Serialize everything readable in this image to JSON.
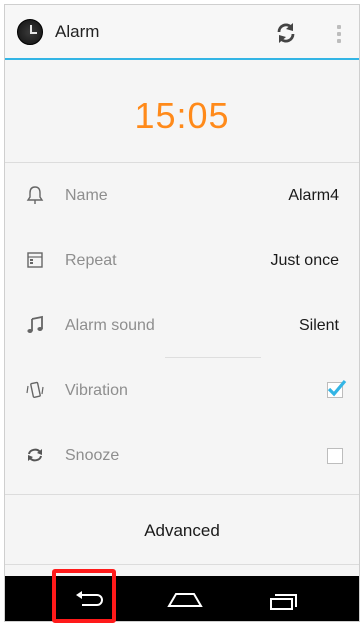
{
  "app": {
    "title": "Alarm",
    "icon": "alarm-clock-icon"
  },
  "action_bar": {
    "refresh_icon": "refresh-icon",
    "overflow_icon": "overflow-menu-icon",
    "accent_color": "#33b5e5"
  },
  "time": {
    "value": "15:05",
    "color": "#ff8a1a"
  },
  "settings": [
    {
      "label": "Name",
      "value": "Alarm4",
      "icon": "bell-icon"
    },
    {
      "label": "Repeat",
      "value": "Just once",
      "icon": "calendar-icon"
    },
    {
      "label": "Alarm sound",
      "value": "Silent",
      "icon": "music-note-icon"
    },
    {
      "label": "Vibration",
      "checked": true,
      "icon": "vibration-icon"
    },
    {
      "label": "Snooze",
      "checked": false,
      "icon": "snooze-icon"
    }
  ],
  "advanced": {
    "label": "Advanced"
  },
  "nav": {
    "back_icon": "back-icon",
    "home_icon": "home-icon",
    "recents_icon": "recents-icon"
  }
}
